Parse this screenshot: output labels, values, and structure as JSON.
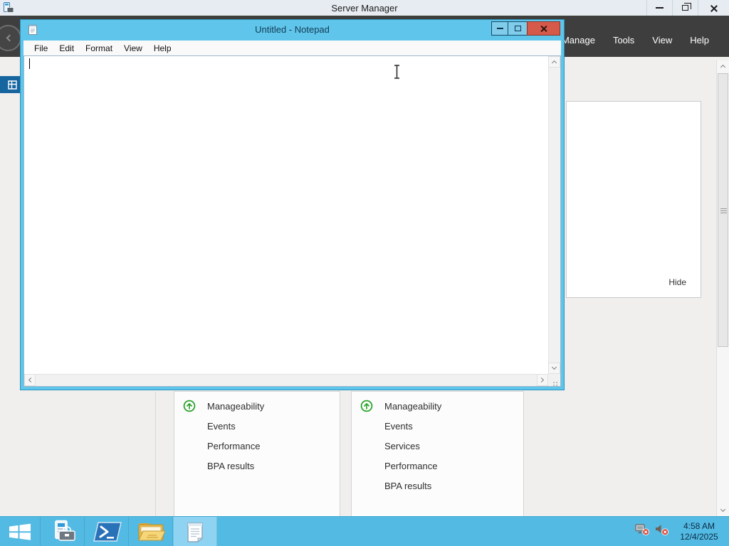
{
  "server_manager": {
    "title": "Server Manager",
    "menu": [
      "Manage",
      "Tools",
      "View",
      "Help"
    ],
    "panel": {
      "hide": "Hide"
    },
    "tiles": [
      {
        "header": "Manageability",
        "items": [
          "Events",
          "Performance",
          "BPA results"
        ]
      },
      {
        "header": "Manageability",
        "items": [
          "Events",
          "Services",
          "Performance",
          "BPA results"
        ]
      }
    ]
  },
  "notepad": {
    "title": "Untitled - Notepad",
    "menu": [
      "File",
      "Edit",
      "Format",
      "View",
      "Help"
    ],
    "text": ""
  },
  "taskbar": {
    "tray": {
      "time": "4:58 AM",
      "date": "12/4/2025"
    }
  },
  "icons": {
    "server_manager_logo": "server-with-toolbox",
    "window_minimize": "minimize-line",
    "window_restore": "overlapping-squares",
    "window_maximize": "square",
    "window_close": "x-cross",
    "back": "circled-left-chevron",
    "sidebar_dashboard": "grid-tiles",
    "sidebar_servers": "server-stack",
    "tile_status": "green-circled-up-arrow",
    "scrollbar_arrows": "chevrons",
    "start": "windows-logo",
    "taskbar_powershell": "powershell-prompt",
    "taskbar_file_explorer": "folder",
    "taskbar_notepad": "notepad-pad",
    "tray_network": "network-with-red-x",
    "tray_volume": "speaker-with-red-x",
    "notepad_logo": "notepad-page",
    "mouse_cursor": "i-beam"
  },
  "colors": {
    "taskbar_blue": "#53bae3",
    "notepad_frame_blue": "#60c5ea",
    "close_button_red": "#d65a49",
    "header_dark": "#3e3e3e",
    "sidebar_selected_blue": "#17659f",
    "status_green": "#2ca32c"
  }
}
